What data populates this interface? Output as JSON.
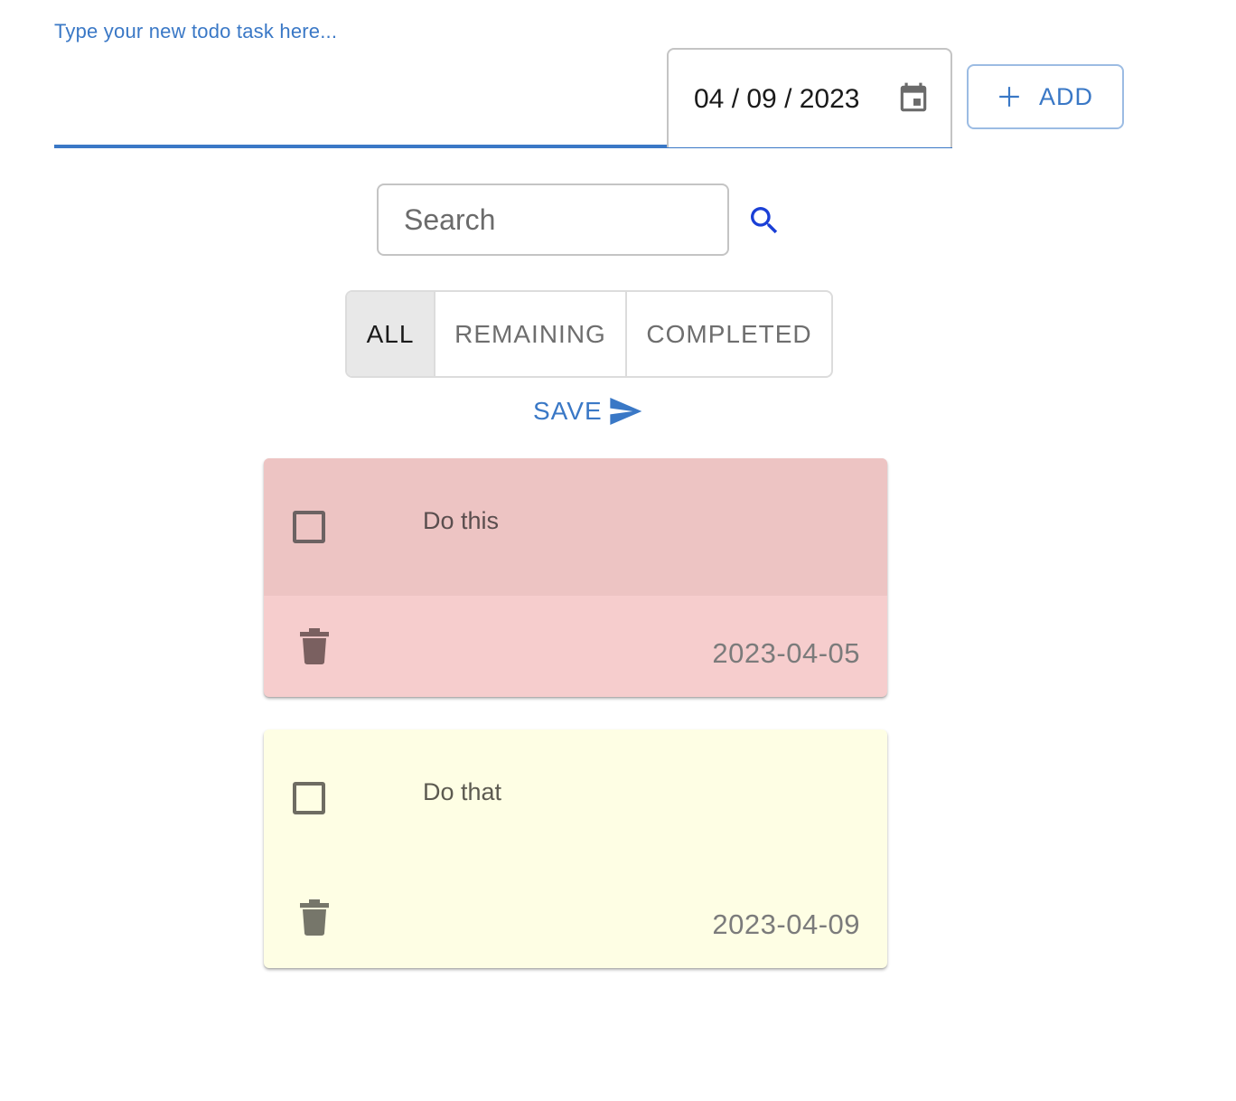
{
  "new_task": {
    "label": "Type your new todo task here...",
    "value": "",
    "date_value": "04 / 09 / 2023",
    "add_label": "ADD"
  },
  "search": {
    "placeholder": "Search",
    "value": ""
  },
  "filters": [
    {
      "label": "ALL",
      "active": true
    },
    {
      "label": "REMAINING",
      "active": false
    },
    {
      "label": "COMPLETED",
      "active": false
    }
  ],
  "save_label": "SAVE",
  "todos": [
    {
      "text": "Do this",
      "date": "2023-04-05",
      "completed": false,
      "color": "#f6cdcd"
    },
    {
      "text": "Do that",
      "date": "2023-04-09",
      "completed": false,
      "color": "#fefee4"
    }
  ],
  "colors": {
    "accent": "#3a78c6",
    "search_icon": "#1a3fd6"
  },
  "icons": {
    "calendar": "calendar-icon",
    "add": "plus-icon",
    "search": "search-icon",
    "save": "send-icon",
    "delete": "trash-icon"
  }
}
